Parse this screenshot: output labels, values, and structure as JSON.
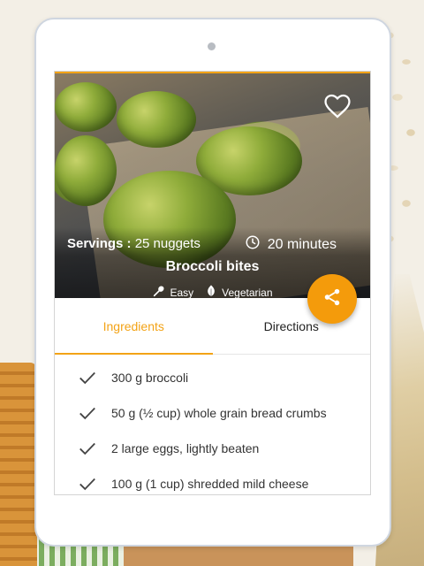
{
  "recipe": {
    "title": "Broccoli bites",
    "servings_label": "Servings :",
    "servings_value": "25 nuggets",
    "time": "20 minutes",
    "tags": [
      {
        "icon": "spoon-icon",
        "label": "Easy"
      },
      {
        "icon": "leaf-icon",
        "label": "Vegetarian"
      }
    ],
    "favorite_icon": "heart-outline-icon",
    "share_icon": "share-icon"
  },
  "tabs": [
    {
      "label": "Ingredients",
      "active": true
    },
    {
      "label": "Directions",
      "active": false
    }
  ],
  "ingredients": [
    "300 g broccoli",
    "50 g (½ cup) whole grain bread crumbs",
    "2 large eggs, lightly beaten",
    "100 g (1 cup) shredded mild cheese"
  ],
  "colors": {
    "accent": "#f3a316",
    "fab": "#f49b0b",
    "text": "#333333"
  }
}
